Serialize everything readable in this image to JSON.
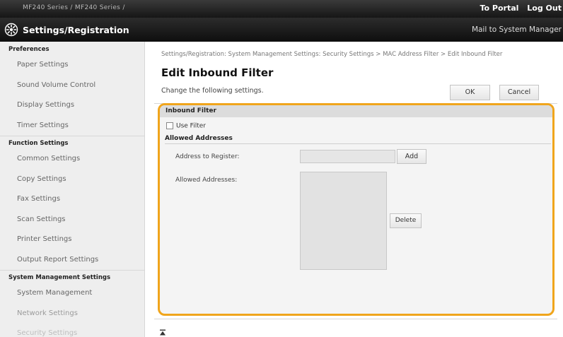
{
  "topbar": {
    "device_name": "MF240 Series / MF240 Series /",
    "portal_link": "To Portal",
    "logout_link": "Log Out"
  },
  "header": {
    "title": "Settings/Registration",
    "mail_link": "Mail to System Manager"
  },
  "sidebar": {
    "sections": [
      {
        "title": "Preferences",
        "items": [
          "Paper Settings",
          "Sound Volume Control",
          "Display Settings",
          "Timer Settings"
        ]
      },
      {
        "title": "Function Settings",
        "items": [
          "Common Settings",
          "Copy Settings",
          "Fax Settings",
          "Scan Settings",
          "Printer Settings",
          "Output Report Settings"
        ]
      },
      {
        "title": "System Management Settings",
        "items": [
          "System Management",
          "Network Settings",
          "Security Settings"
        ]
      }
    ]
  },
  "main": {
    "breadcrumb": "Settings/Registration: System Management Settings: Security Settings > MAC Address Filter > Edit Inbound Filter",
    "page_title": "Edit Inbound Filter",
    "instruction": "Change the following settings.",
    "ok_label": "OK",
    "cancel_label": "Cancel",
    "panel": {
      "title": "Inbound Filter",
      "use_filter_label": "Use Filter",
      "use_filter_checked": false,
      "allowed_title": "Allowed Addresses",
      "address_to_register_label": "Address to Register:",
      "address_value": "",
      "add_label": "Add",
      "allowed_addresses_label": "Allowed Addresses:",
      "allowed_addresses": [],
      "delete_label": "Delete"
    },
    "highlight_color": "#f0a51c"
  }
}
